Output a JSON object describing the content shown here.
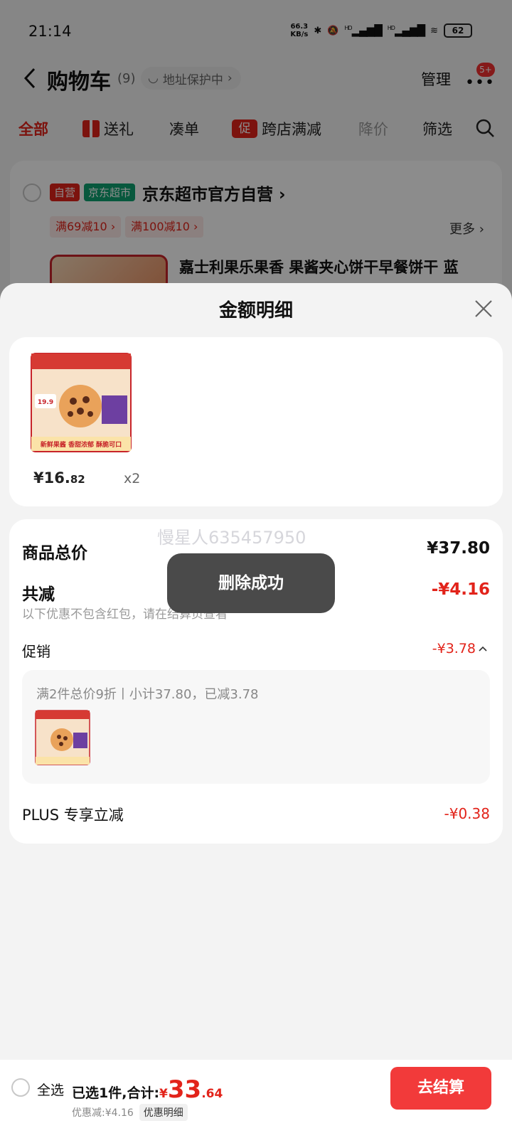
{
  "status_bar": {
    "time": "21:14",
    "net_speed_top": "66.3",
    "net_speed_bottom": "KB/s",
    "hd1": "HD",
    "hd2": "HD",
    "battery": "62"
  },
  "nav": {
    "title": "购物车",
    "count": "(9)",
    "address": "地址保护中",
    "manage": "管理",
    "badge": "5+"
  },
  "tabs": [
    {
      "label": "全部"
    },
    {
      "label": "送礼"
    },
    {
      "label": "凑单"
    },
    {
      "label": "跨店满减",
      "icon_text": "促"
    },
    {
      "label": "降价"
    },
    {
      "label": "筛选"
    }
  ],
  "store": {
    "self_tag": "自营",
    "jd_tag": "京东超市",
    "name": "京东超市官方自营",
    "coupons": [
      "满69减10",
      "满100减10"
    ],
    "more": "更多",
    "product_title": "嘉士利果乐果香 果酱夹心饼干早餐饼干 蓝"
  },
  "sheet": {
    "title": "金额明细",
    "product": {
      "price_int": "¥16.",
      "price_dec": "82",
      "qty": "x2",
      "image_texts": [
        "新鲜果酱 香甜浓郁 酥脆可口",
        "19.9"
      ]
    },
    "total_label": "商品总价",
    "total_value": "¥37.80",
    "reduce_label": "共减",
    "reduce_value": "-¥4.16",
    "note": "以下优惠不包含红包，请在结算页查看",
    "promo_label": "促销",
    "promo_value": "-¥3.78",
    "promo_desc": "满2件总价9折丨小计37.80，已减3.78",
    "plus_label": "PLUS 专享立减",
    "plus_value": "-¥0.38",
    "watermark": "慢星人635457950"
  },
  "toast": "删除成功",
  "bottom": {
    "select_all": "全选",
    "summary_prefix": "已选1件,合计:",
    "yen": "¥",
    "amount_int": "33",
    "amount_dec": ".64",
    "discount": "优惠减:¥4.16",
    "detail_chip": "优惠明细",
    "checkout": "去结算"
  },
  "colors": {
    "accent": "#e2231a",
    "checkout": "#f23a3a",
    "jd_green": "#0ea06f"
  }
}
